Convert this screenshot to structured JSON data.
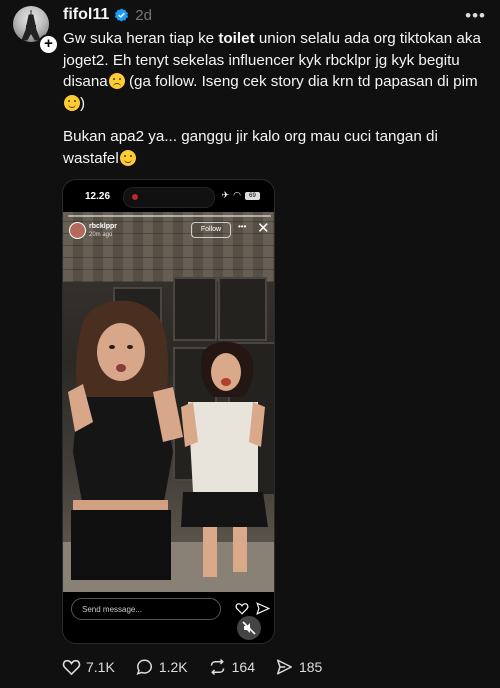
{
  "post": {
    "username": "fifol11",
    "time": "2d",
    "paragraph1_start": "Gw suka heran tiap ke ",
    "paragraph1_bold": "toilet",
    "paragraph1_mid": " union selalu ada org tiktokan aka joget2. Eh tenyt sekelas influencer kyk rbcklpr jg kyk begitu disana",
    "paragraph1_end": " (ga follow. Iseng cek story dia krn td papasan di pim",
    "paragraph1_close": ")",
    "paragraph2": "Bukan apa2 ya... ganggu jir kalo org mau cuci tangan di wastafel"
  },
  "screenshot": {
    "clock": "12.26",
    "battery": "69",
    "story_user": "rbcklppr",
    "story_time": "20m ago",
    "follow_label": "Follow",
    "message_placeholder": "Send message..."
  },
  "actions": {
    "likes": "7.1K",
    "replies": "1.2K",
    "reposts": "164",
    "shares": "185"
  },
  "colors": {
    "background": "#101010",
    "text": "#f3f5f7",
    "verified": "#1d9bf0"
  }
}
